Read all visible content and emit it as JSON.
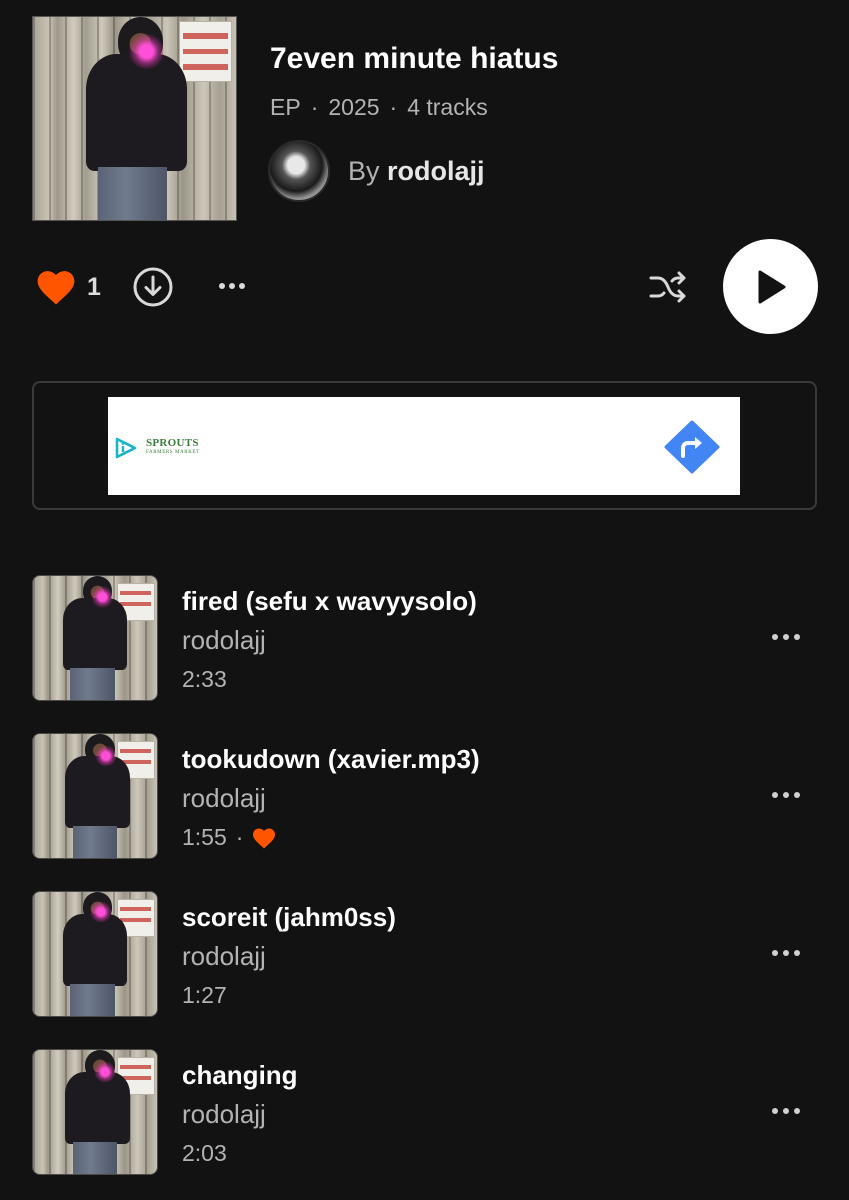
{
  "header": {
    "title": "7even minute hiatus",
    "type": "EP",
    "year": "2025",
    "track_count": "4 tracks",
    "by_prefix": "By",
    "artist": "rodolajj",
    "meta_separator": "·"
  },
  "actions": {
    "like_count": "1",
    "accent_color": "#ff5500",
    "icons": [
      "heart-icon",
      "download-icon",
      "more-icon",
      "shuffle-icon",
      "play-icon"
    ]
  },
  "ad": {
    "brand": "SPROUTS",
    "tagline": "FARMERS MARKET",
    "brand_color": "#3a7d3a",
    "directions_color": "#4285f4"
  },
  "tracks": [
    {
      "title": "fired (sefu x wavyysolo)",
      "artist": "rodolajj",
      "duration": "2:33",
      "liked": false
    },
    {
      "title": "tookudown (xavier.mp3)",
      "artist": "rodolajj",
      "duration": "1:55",
      "liked": true
    },
    {
      "title": "scoreit (jahm0ss)",
      "artist": "rodolajj",
      "duration": "1:27",
      "liked": false
    },
    {
      "title": "changing",
      "artist": "rodolajj",
      "duration": "2:03",
      "liked": false
    }
  ]
}
